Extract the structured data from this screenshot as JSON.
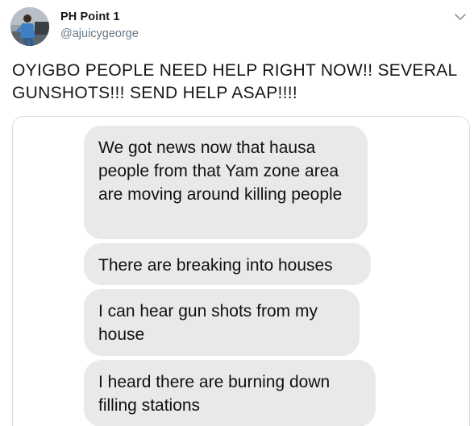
{
  "author": {
    "display_name": "PH Point 1",
    "handle": "@ajuicygeorge",
    "avatar_icon": "profile-photo",
    "menu_icon": "chevron-down-icon"
  },
  "tweet": {
    "text": "OYIGBO PEOPLE NEED HELP RIGHT NOW!! SEVERAL GUNSHOTS!!! SEND HELP ASAP!!!!"
  },
  "screenshot": {
    "messages": [
      "We got news now that hausa people from that Yam zone area are moving around killing people",
      "There are breaking into houses",
      "I can hear gun shots from my house",
      "I heard there are burning down filling stations"
    ]
  },
  "colors": {
    "bubble_bg": "#e9e9eb",
    "handle_gray": "#657786",
    "border": "#d6dde3"
  }
}
